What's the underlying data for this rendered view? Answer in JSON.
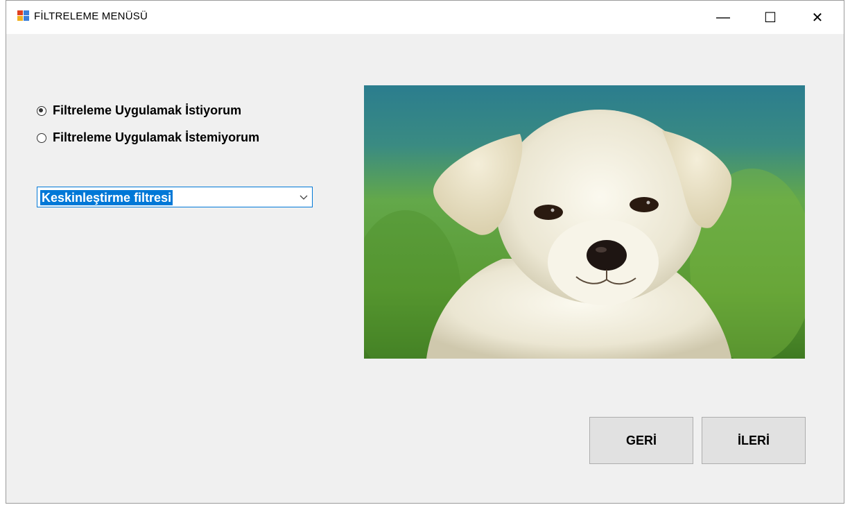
{
  "window": {
    "title": "FİLTRELEME MENÜSÜ",
    "controls": {
      "minimize": "—",
      "maximize": "☐",
      "close": "✕"
    }
  },
  "filter_options": [
    {
      "label": "Filtreleme Uygulamak İstiyorum",
      "checked": true
    },
    {
      "label": "Filtreleme Uygulamak İstemiyorum",
      "checked": false
    }
  ],
  "filter_select": {
    "selected": "Keskinleştirme filtresi"
  },
  "preview_image": {
    "icon": "puppy-photo"
  },
  "buttons": {
    "back": "GERİ",
    "next": "İLERİ"
  },
  "colors": {
    "accent": "#0078d7",
    "form_bg": "#f0f0f0",
    "button_bg": "#e1e1e1"
  }
}
